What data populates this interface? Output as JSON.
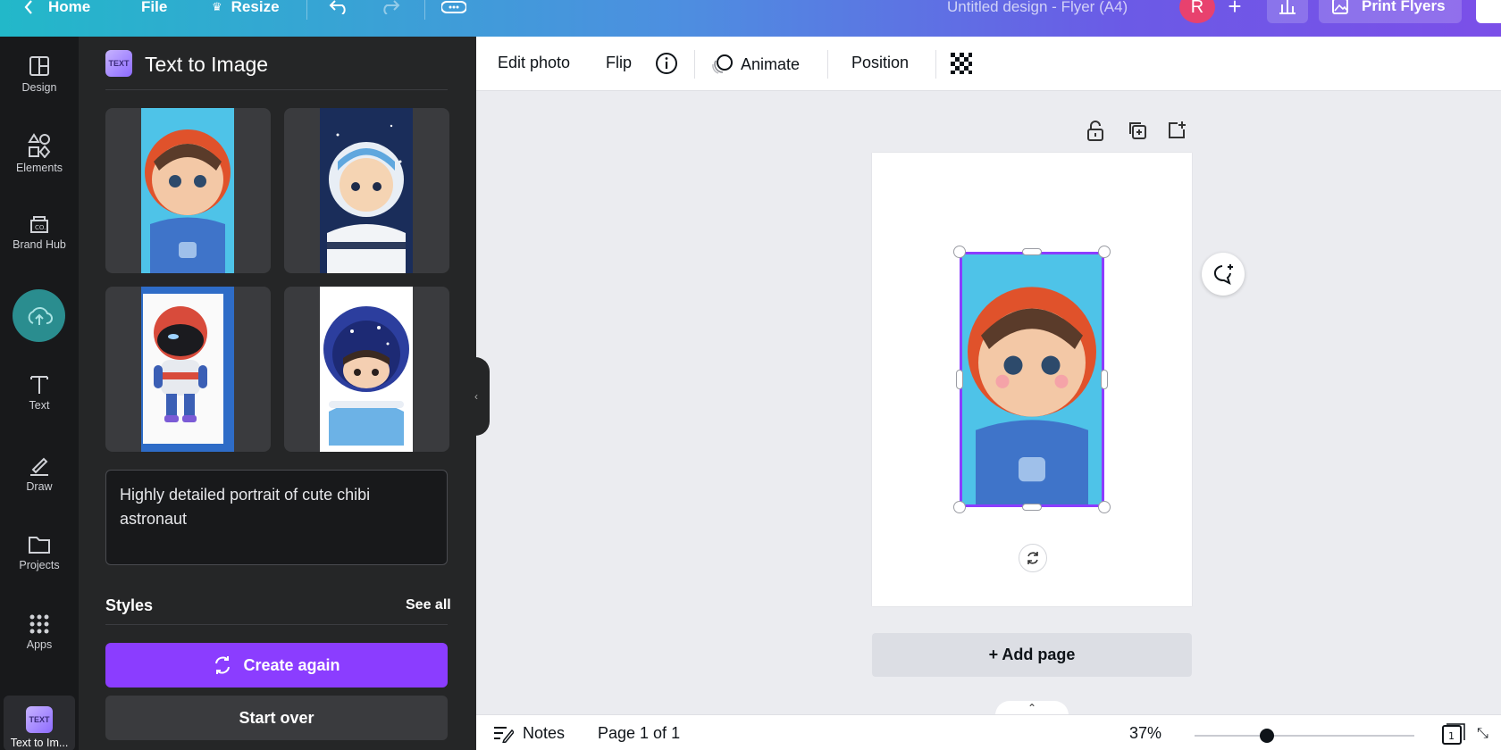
{
  "topbar": {
    "home_label": "Home",
    "file_label": "File",
    "resize_label": "Resize",
    "design_title": "Untitled design - Flyer (A4)",
    "avatar_initial": "R",
    "print_label": "Print Flyers"
  },
  "rail": {
    "items": [
      {
        "label": "Design",
        "icon": "layout-icon"
      },
      {
        "label": "Elements",
        "icon": "shapes-icon"
      },
      {
        "label": "Brand Hub",
        "icon": "brand-icon"
      },
      {
        "label": "",
        "icon": "upload-cloud-icon"
      },
      {
        "label": "Text",
        "icon": "text-icon"
      },
      {
        "label": "Draw",
        "icon": "pen-icon"
      },
      {
        "label": "Projects",
        "icon": "folder-icon"
      },
      {
        "label": "Apps",
        "icon": "grid-icon"
      }
    ],
    "active_label": "Text to Im...",
    "active_logo": "TEXT"
  },
  "panel": {
    "title": "Text to Image",
    "prompt": "Highly detailed portrait of cute chibi astronaut",
    "styles_label": "Styles",
    "see_all": "See all",
    "create_again": "Create again",
    "start_over": "Start over"
  },
  "toolbar": {
    "edit_photo": "Edit photo",
    "flip": "Flip",
    "animate": "Animate",
    "position": "Position"
  },
  "canvas": {
    "add_page": "+ Add page"
  },
  "footer": {
    "notes": "Notes",
    "page_indicator": "Page 1 of 1",
    "zoom": "37%",
    "page_count": "1",
    "zoom_level": 0.37
  },
  "colors": {
    "accent": "#8b3dff",
    "rail_bg": "#18191b",
    "panel_bg": "#252627"
  }
}
